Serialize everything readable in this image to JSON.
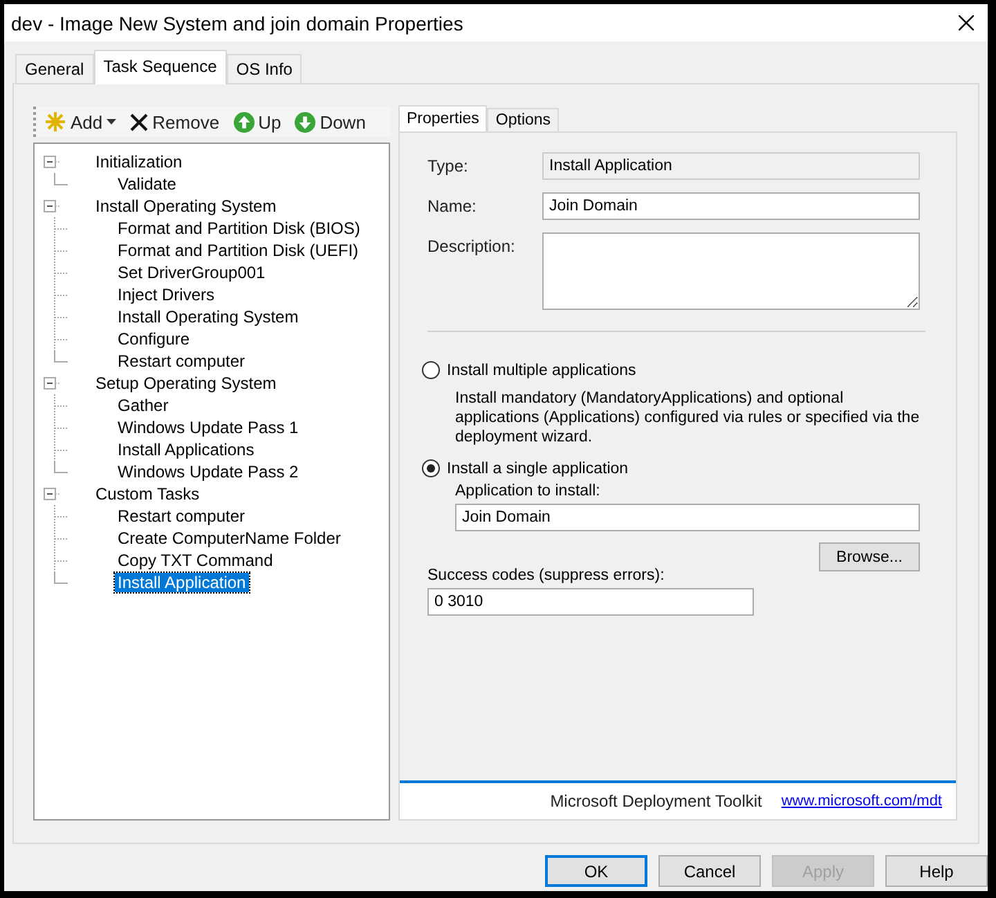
{
  "window": {
    "title": "dev - Image New System and join domain Properties"
  },
  "tabs": [
    {
      "label": "General",
      "selected": false
    },
    {
      "label": "Task Sequence",
      "selected": true
    },
    {
      "label": "OS Info",
      "selected": false
    }
  ],
  "toolbar": [
    {
      "label": "Add",
      "kind": "add"
    },
    {
      "label": "Remove",
      "kind": "remove"
    },
    {
      "label": "Up",
      "kind": "up"
    },
    {
      "label": "Down",
      "kind": "down"
    }
  ],
  "tree": [
    {
      "label": "Initialization",
      "expanded": true,
      "selected": false,
      "children": [
        {
          "label": "Validate",
          "selected": false
        }
      ]
    },
    {
      "label": "Install Operating System",
      "expanded": true,
      "selected": false,
      "children": [
        {
          "label": "Format and Partition Disk (BIOS)",
          "selected": false
        },
        {
          "label": "Format and Partition Disk (UEFI)",
          "selected": false
        },
        {
          "label": "Set DriverGroup001",
          "selected": false
        },
        {
          "label": "Inject Drivers",
          "selected": false
        },
        {
          "label": "Install Operating System",
          "selected": false
        },
        {
          "label": "Configure",
          "selected": false
        },
        {
          "label": "Restart computer",
          "selected": false
        }
      ]
    },
    {
      "label": "Setup Operating System",
      "expanded": true,
      "selected": false,
      "children": [
        {
          "label": "Gather",
          "selected": false
        },
        {
          "label": "Windows Update Pass 1",
          "selected": false
        },
        {
          "label": "Install Applications",
          "selected": false
        },
        {
          "label": "Windows Update Pass 2",
          "selected": false
        }
      ]
    },
    {
      "label": "Custom Tasks",
      "expanded": true,
      "selected": false,
      "children": [
        {
          "label": "Restart computer",
          "selected": false
        },
        {
          "label": "Create ComputerName Folder",
          "selected": false
        },
        {
          "label": "Copy TXT Command",
          "selected": false
        },
        {
          "label": "Install Application",
          "selected": true
        }
      ]
    }
  ],
  "properties": {
    "tabs": [
      {
        "label": "Properties",
        "selected": true
      },
      {
        "label": "Options",
        "selected": false
      }
    ],
    "type": {
      "label": "Type:",
      "value": "Install Application",
      "disabled": true
    },
    "name": {
      "label": "Name:",
      "value": "Join Domain"
    },
    "description": {
      "label": "Description:"
    },
    "options": [
      {
        "label": "Install multiple applications",
        "selected": false,
        "note": "Install mandatory (MandatoryApplications) and optional applications (Applications) configured via rules or specified via the deployment wizard."
      },
      {
        "label": "Install a single application",
        "selected": true
      }
    ],
    "application": {
      "label": "Application to install:",
      "value": "Join Domain"
    },
    "browse": "Browse...",
    "success_codes": {
      "label": "Success codes (suppress errors):",
      "value": "0 3010"
    },
    "footer": {
      "text": "Microsoft Deployment Toolkit",
      "link": "www.microsoft.com/mdt"
    }
  },
  "buttons": [
    {
      "label": "OK",
      "default": true,
      "disabled": false
    },
    {
      "label": "Cancel",
      "default": false,
      "disabled": false
    },
    {
      "label": "Apply",
      "default": false,
      "disabled": true
    },
    {
      "label": "Help",
      "default": false,
      "disabled": false
    }
  ]
}
